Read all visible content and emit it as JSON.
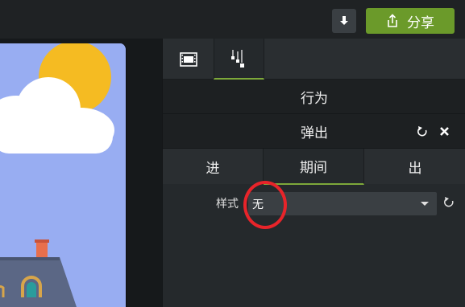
{
  "toolbar": {
    "download_icon": "download-arrow-icon",
    "share_label": "分享",
    "share_icon": "share-upload-icon",
    "share_color": "#6b9a2a"
  },
  "panel": {
    "tabs": [
      {
        "name": "film-strip-icon"
      },
      {
        "name": "animation-effects-icon"
      }
    ],
    "behavior_title": "行为",
    "effect_name": "弹出",
    "phases": [
      "进",
      "期间",
      "出"
    ],
    "style_label": "样式",
    "style_value": "无",
    "accent_color": "#7da83a"
  },
  "annotation": {
    "circle_color": "#e8242a"
  }
}
